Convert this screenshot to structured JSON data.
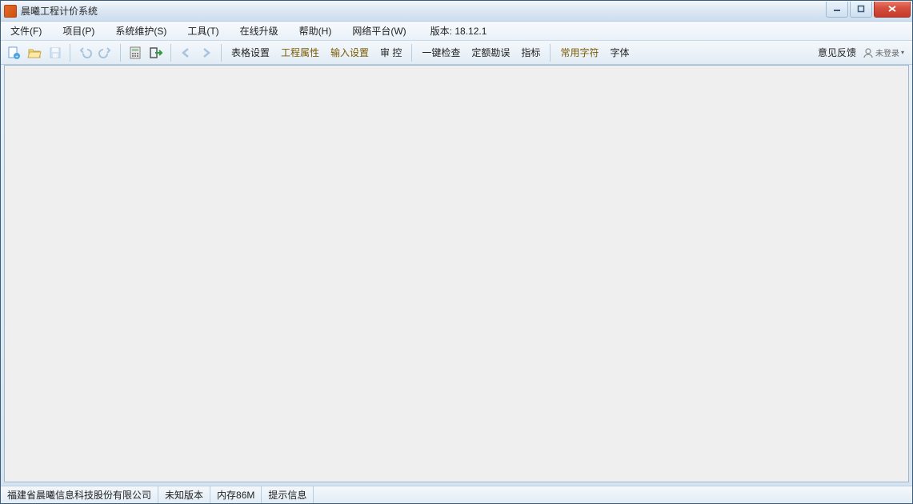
{
  "window": {
    "title": "晨曦工程计价系统",
    "app_icon_glyph": "曦"
  },
  "menu": {
    "file": "文件(F)",
    "project": "项目(P)",
    "maintenance": "系统维护(S)",
    "tools": "工具(T)",
    "upgrade": "在线升级",
    "help": "帮助(H)",
    "network": "网络平台(W)",
    "version_label": "版本: 18.12.1"
  },
  "toolbar": {
    "table_settings": "表格设置",
    "project_properties": "工程属性",
    "input_settings": "输入设置",
    "audit": "审   控",
    "one_click_check": "一键检查",
    "quota_errata": "定额勘误",
    "indicator": "指标",
    "common_chars": "常用字符",
    "font": "字体",
    "feedback": "意见反馈",
    "user_status": "未登录"
  },
  "status": {
    "company": "福建省晨曦信息科技股份有限公司",
    "version": "未知版本",
    "memory": "内存86M",
    "hint": "提示信息"
  }
}
